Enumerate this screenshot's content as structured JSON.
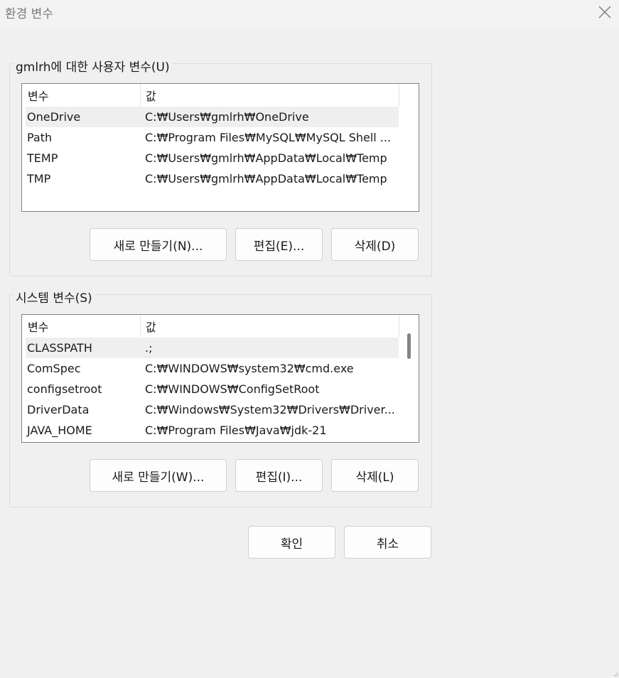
{
  "window": {
    "title": "환경 변수",
    "close_icon": "close-icon"
  },
  "user_vars": {
    "legend": "gmlrh에 대한 사용자 변수(U)",
    "headers": {
      "name": "변수",
      "value": "값"
    },
    "rows": [
      {
        "name": "OneDrive",
        "value": "C:₩Users₩gmlrh₩OneDrive"
      },
      {
        "name": "Path",
        "value": "C:₩Program Files₩MySQL₩MySQL Shell ..."
      },
      {
        "name": "TEMP",
        "value": "C:₩Users₩gmlrh₩AppData₩Local₩Temp"
      },
      {
        "name": "TMP",
        "value": "C:₩Users₩gmlrh₩AppData₩Local₩Temp"
      }
    ],
    "buttons": {
      "new": "새로 만들기(N)...",
      "edit": "편집(E)...",
      "delete": "삭제(D)"
    }
  },
  "system_vars": {
    "legend": "시스템 변수(S)",
    "headers": {
      "name": "변수",
      "value": "값"
    },
    "rows": [
      {
        "name": "CLASSPATH",
        "value": ".;"
      },
      {
        "name": "ComSpec",
        "value": "C:₩WINDOWS₩system32₩cmd.exe"
      },
      {
        "name": "configsetroot",
        "value": "C:₩WINDOWS₩ConfigSetRoot"
      },
      {
        "name": "DriverData",
        "value": "C:₩Windows₩System32₩Drivers₩Driver..."
      },
      {
        "name": "JAVA_HOME",
        "value": "C:₩Program Files₩Java₩jdk-21"
      }
    ],
    "buttons": {
      "new": "새로 만들기(W)...",
      "edit": "편집(I)...",
      "delete": "삭제(L)"
    }
  },
  "dialog_buttons": {
    "ok": "확인",
    "cancel": "취소"
  }
}
